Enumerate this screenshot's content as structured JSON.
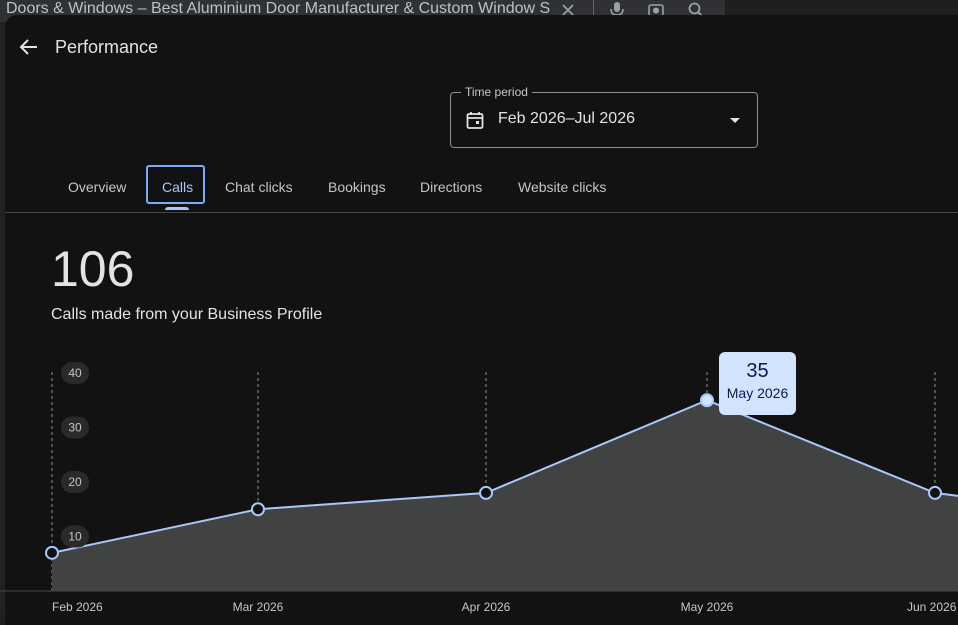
{
  "browser": {
    "search_query": "Doors & Windows – Best Aluminium Door Manufacturer & Custom Window S"
  },
  "header": {
    "title": "Performance"
  },
  "time_period": {
    "label": "Time period",
    "value": "Feb 2026–Jul 2026"
  },
  "tabs": [
    {
      "label": "Overview"
    },
    {
      "label": "Calls",
      "active": true
    },
    {
      "label": "Chat clicks"
    },
    {
      "label": "Bookings"
    },
    {
      "label": "Directions"
    },
    {
      "label": "Website clicks"
    }
  ],
  "summary": {
    "total": "106",
    "description": "Calls made from your Business Profile"
  },
  "tooltip": {
    "value": "35",
    "label": "May 2026"
  },
  "colors": {
    "accent": "#a8c7fa",
    "line": "#a8c7fa",
    "area": "#444746",
    "panel": "#121212"
  },
  "chart_data": {
    "type": "area",
    "x": [
      "Feb 2026",
      "Mar 2026",
      "Apr 2026",
      "May 2026",
      "Jun 2026"
    ],
    "values": [
      7,
      15,
      18,
      35,
      18
    ],
    "yticks": [
      10,
      20,
      30,
      40
    ],
    "ylim": [
      0,
      40
    ],
    "grid": "vertical-dashed",
    "highlight_index": 3
  }
}
